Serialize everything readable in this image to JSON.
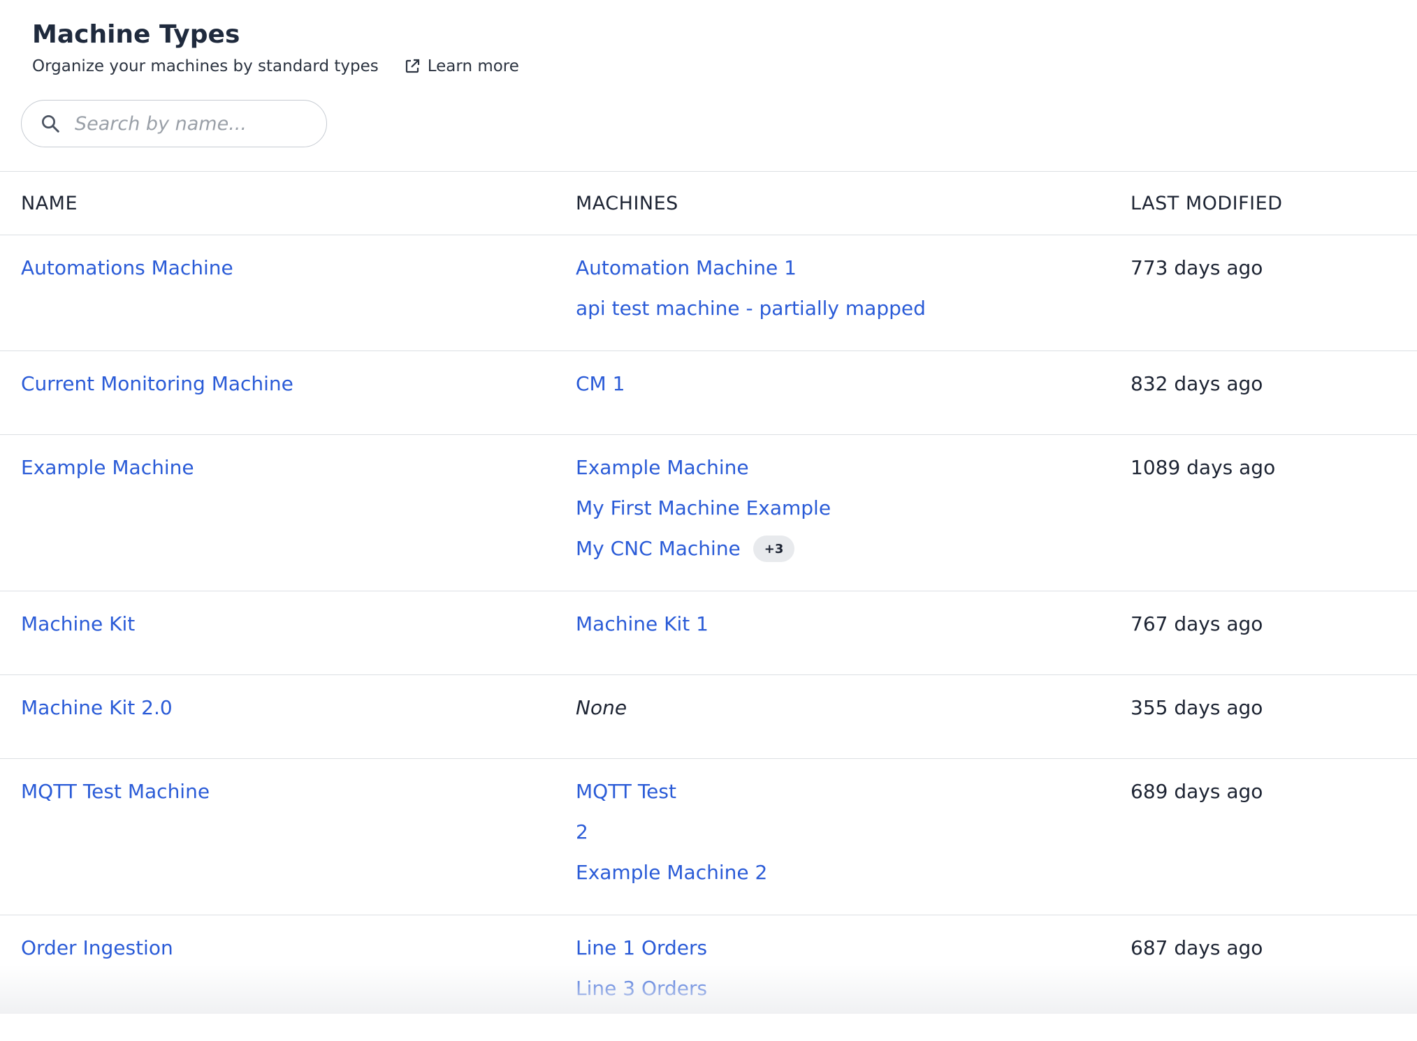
{
  "header": {
    "title": "Machine Types",
    "subtitle": "Organize your machines by standard types",
    "learn_more": "Learn more"
  },
  "search": {
    "placeholder": "Search by name...",
    "value": ""
  },
  "table": {
    "columns": {
      "name": "NAME",
      "machines": "MACHINES",
      "modified": "LAST MODIFIED"
    },
    "rows": [
      {
        "name": "Automations Machine",
        "machines": [
          "Automation Machine 1",
          "api test machine - partially mapped"
        ],
        "extra": "",
        "none": "",
        "modified": "773 days ago"
      },
      {
        "name": "Current Monitoring Machine",
        "machines": [
          "CM 1"
        ],
        "extra": "",
        "none": "",
        "modified": "832 days ago"
      },
      {
        "name": "Example Machine",
        "machines": [
          "Example Machine",
          "My First Machine Example",
          "My CNC Machine"
        ],
        "extra": "+3",
        "none": "",
        "modified": "1089 days ago"
      },
      {
        "name": "Machine Kit",
        "machines": [
          "Machine Kit 1"
        ],
        "extra": "",
        "none": "",
        "modified": "767 days ago"
      },
      {
        "name": "Machine Kit 2.0",
        "machines": [],
        "extra": "",
        "none": "None",
        "modified": "355 days ago"
      },
      {
        "name": "MQTT Test Machine",
        "machines": [
          "MQTT Test",
          "2",
          "Example Machine 2"
        ],
        "extra": "",
        "none": "",
        "modified": "689 days ago"
      },
      {
        "name": "Order Ingestion",
        "machines": [
          "Line 1 Orders",
          "Line 3 Orders"
        ],
        "extra": "",
        "none": "",
        "modified": "687 days ago"
      }
    ]
  }
}
